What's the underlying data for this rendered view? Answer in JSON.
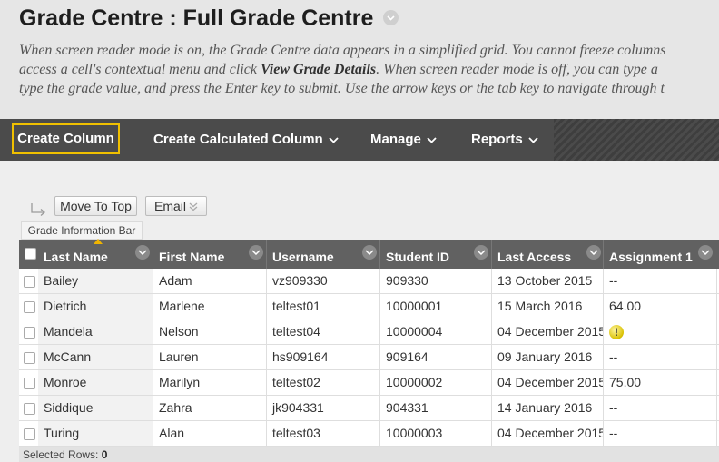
{
  "page": {
    "title": "Grade Centre : Full Grade Centre",
    "instructions": [
      "When screen reader mode is on, the Grade Centre data appears in a simplified grid. You cannot freeze columns",
      "access a cell's contextual menu and click",
      "View Grade Details",
      ". When screen reader mode is off, you can type a",
      "type the grade value, and press the Enter key to submit. Use the arrow keys or the tab key to navigate through t"
    ]
  },
  "action_bar": {
    "create_column": "Create Column",
    "create_calculated_column": "Create Calculated Column",
    "manage": "Manage",
    "reports": "Reports"
  },
  "toolbar": {
    "move_to_top": "Move To Top",
    "email": "Email",
    "grade_information_bar": "Grade Information Bar"
  },
  "grid": {
    "headers": {
      "last_name": "Last Name",
      "first_name": "First Name",
      "username": "Username",
      "student_id": "Student ID",
      "last_access": "Last Access",
      "assignment_1": "Assignment 1"
    },
    "rows": [
      {
        "last": "Bailey",
        "first": "Adam",
        "user": "vz909330",
        "sid": "909330",
        "access": "13 October 2015",
        "a1": "--"
      },
      {
        "last": "Dietrich",
        "first": "Marlene",
        "user": "teltest01",
        "sid": "10000001",
        "access": "15 March 2016",
        "a1": "64.00"
      },
      {
        "last": "Mandela",
        "first": "Nelson",
        "user": "teltest04",
        "sid": "10000004",
        "access": "04 December 2015",
        "a1": "!"
      },
      {
        "last": "McCann",
        "first": "Lauren",
        "user": "hs909164",
        "sid": "909164",
        "access": "09 January 2016",
        "a1": "--"
      },
      {
        "last": "Monroe",
        "first": "Marilyn",
        "user": "teltest02",
        "sid": "10000002",
        "access": "04 December 2015",
        "a1": "75.00"
      },
      {
        "last": "Siddique",
        "first": "Zahra",
        "user": "jk904331",
        "sid": "904331",
        "access": "14 January 2016",
        "a1": "--"
      },
      {
        "last": "Turing",
        "first": "Alan",
        "user": "teltest03",
        "sid": "10000003",
        "access": "04 December 2015",
        "a1": "--"
      }
    ]
  },
  "footer": {
    "selected_rows_label": "Selected Rows:",
    "selected_rows_count": "0"
  },
  "colors": {
    "accent": "#f0c000",
    "action_bar": "#4b4b4b",
    "grid_header": "#616161"
  }
}
